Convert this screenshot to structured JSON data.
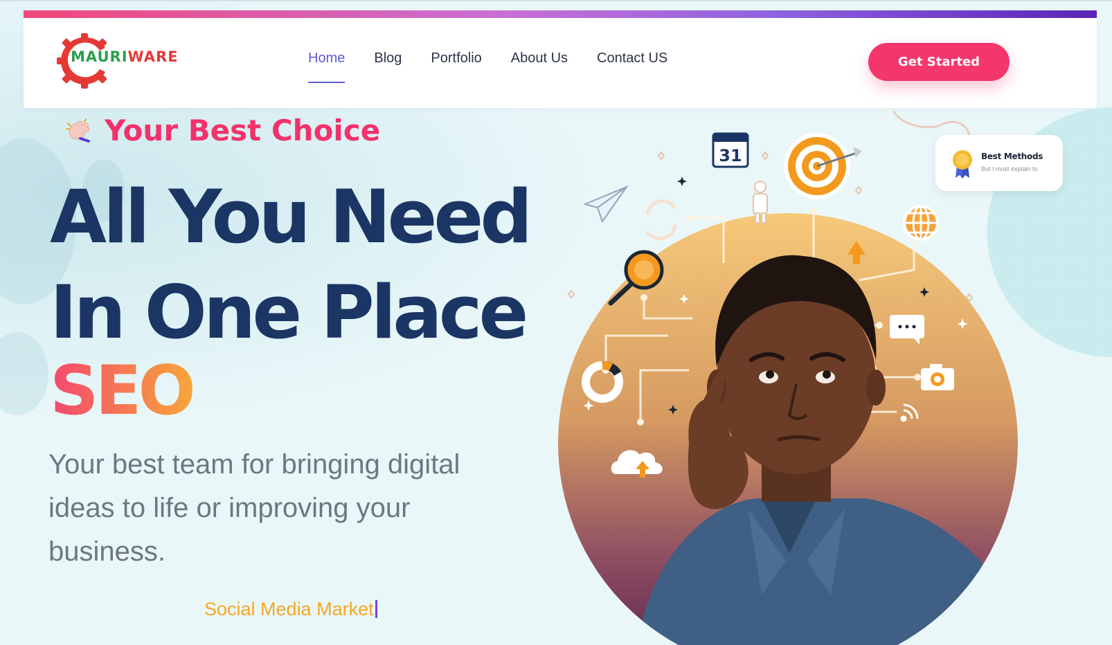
{
  "brand": {
    "logo_text_part1": "MAURI",
    "logo_text_part2": "WARE",
    "colors": {
      "gear": "#e53935",
      "text_green": "#2a9d4f",
      "text_red": "#e53935"
    }
  },
  "nav": {
    "items": [
      {
        "label": "Home",
        "active": true
      },
      {
        "label": "Blog"
      },
      {
        "label": "Portfolio"
      },
      {
        "label": "About Us"
      },
      {
        "label": "Contact US"
      }
    ]
  },
  "header": {
    "cta_label": "Get Started"
  },
  "hero": {
    "eyebrow": "Your Best Choice",
    "headline_line1": "All You Need",
    "headline_line2": "In One Place",
    "highlight": "SEO",
    "subtitle": "Your best team for bringing digital ideas to life or improving your business.",
    "typed_text": "Social Media Market"
  },
  "badge": {
    "title": "Best Methods",
    "subtitle": "But I must explain to"
  },
  "illustration": {
    "calendar_day": "31",
    "icons": [
      "calendar-icon",
      "target-icon",
      "paper-plane-icon",
      "refresh-icon",
      "person-icon",
      "globe-icon",
      "magnifier-icon",
      "arrow-up-icon",
      "chat-bubble-icon",
      "pie-chart-icon",
      "camera-icon",
      "wifi-icon",
      "cloud-upload-icon"
    ]
  },
  "colors": {
    "accent_pink": "#f4366c",
    "nav_active": "#5b5bd6",
    "headline": "#1b3664",
    "typed": "#f5a623"
  }
}
